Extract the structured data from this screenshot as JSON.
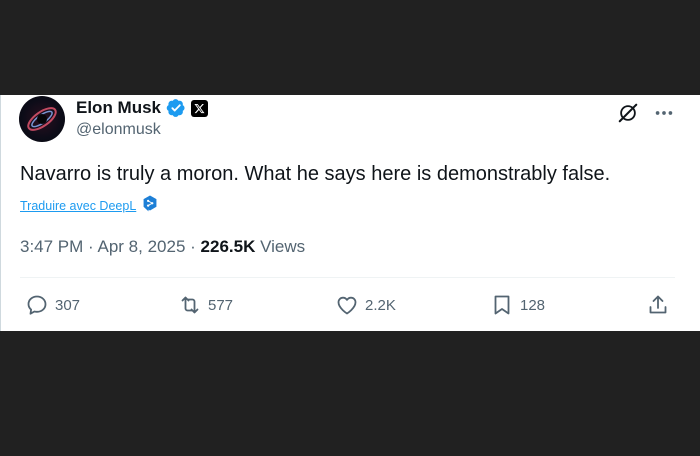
{
  "author": {
    "display_name": "Elon Musk",
    "handle": "@elonmusk",
    "verified_icon": "verified-badge-icon",
    "affiliation_icon": "x-logo-icon"
  },
  "tweet": {
    "text": "Navarro is truly a moron. What he says here is demonstrably false.",
    "translate_label": "Traduire avec DeepL",
    "time": "3:47 PM",
    "date": "Apr 8, 2025",
    "views_count": "226.5K",
    "views_label": "Views"
  },
  "actions": {
    "replies": "307",
    "reposts": "577",
    "likes": "2.2K",
    "bookmarks": "128"
  },
  "colors": {
    "accent": "#1d9bf0",
    "text_primary": "#0f1419",
    "text_secondary": "#536471",
    "page_background": "#212121"
  }
}
